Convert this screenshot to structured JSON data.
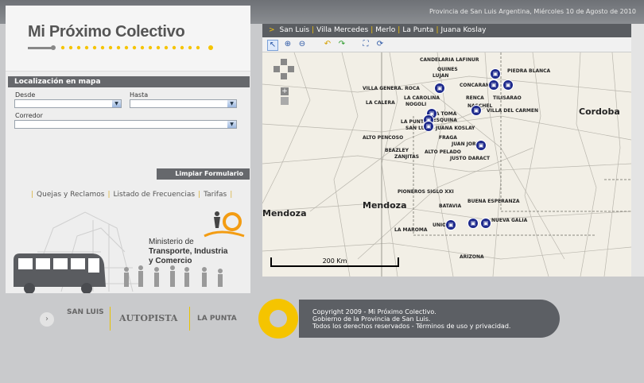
{
  "header": {
    "date": "Provincia de San Luis   Argentina, Miércoles 10 de Agosto de 2010"
  },
  "logo": {
    "title": "Mi Próximo Colectivo"
  },
  "form": {
    "section_title": "Localización en mapa",
    "desde_label": "Desde",
    "hasta_label": "Hasta",
    "corredor_label": "Corredor",
    "desde_value": "",
    "hasta_value": "",
    "corredor_value": "",
    "clear_label": "Limpiar Formulario"
  },
  "links": {
    "quejas": "Quejas y Reclamos",
    "frecuencias": "Listado de Frecuencias",
    "tarifas": "Tarifas"
  },
  "ministerio": {
    "line1": "Ministerio de",
    "line2": "Transporte, Industria",
    "line3": "y Comercio"
  },
  "map": {
    "tabs": [
      "San Luis",
      "Villa Mercedes",
      "Merlo",
      "La Punta",
      "Juana Koslay"
    ],
    "scale_label": "200 Km",
    "labels": {
      "candelaria": "CANDELARIA LAFINUR",
      "quines": "QUINES",
      "lujan": "LUJAN",
      "piedra": "PIEDRA BLANCA",
      "concaran": "CONCARAN",
      "tilisarao": "TILISARAO",
      "villa_general": "VILLA GENERA. ROCA",
      "carolina": "LA CAROLINA",
      "nogoli": "NOGOLI",
      "calera": "LA CALERA",
      "renca": "RENCA",
      "naschel": "NASCHEL",
      "villa_carmen": "VILLA DEL CARMEN",
      "latoma": "LA TOMA",
      "esquina": "LA ESQUINA",
      "juana": "JUANA KOSLAY",
      "lapunta": "LA PUNTA",
      "sanluis": "SAN LUIS",
      "fraga": "FRAGA",
      "pencoso": "ALTO PENCOSO",
      "juanjorba": "JUAN JORBA",
      "beazley": "BEAZLEY",
      "zanjitas": "ZANJITAS",
      "pelado": "ALTO PELADO",
      "justo": "JUSTO DARACT",
      "cordoba": "Cordoba",
      "pioneros": "PIONEROS SIGLO XXI",
      "mendoza_city": "Mendoza",
      "mendoza_left": "Mendoza",
      "batavia": "BATAVIA",
      "esperanza": "BUENA ESPERANZA",
      "maroma": "LA MAROMA",
      "unión": "UNION",
      "nueva_galia": "NUEVA GALIA",
      "arizona": "ARIZONA"
    }
  },
  "footer": {
    "copyright_1": "Copyright 2009 - Mi Próximo Colectivo.",
    "copyright_2": "Gobierno de la Provincia de San Luis.",
    "copyright_3": "Todos los derechos reservados - Términos de uso y privacidad.",
    "logo_sanluis": "SAN LUIS",
    "logo_autopista": "AUTOPISTA",
    "logo_lapunta": "LA PUNTA"
  }
}
